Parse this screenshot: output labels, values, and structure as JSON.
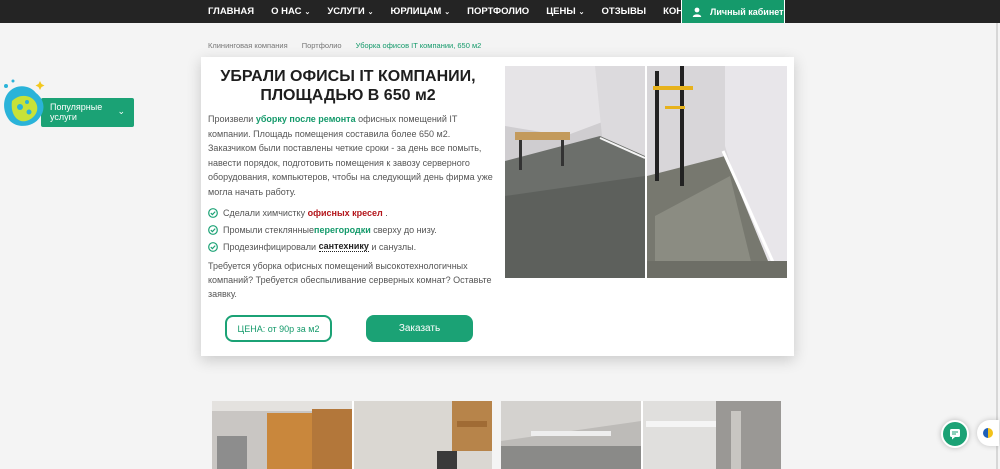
{
  "nav": {
    "items": [
      {
        "label": "ГЛАВНАЯ",
        "has_menu": false
      },
      {
        "label": "О НАС",
        "has_menu": true
      },
      {
        "label": "УСЛУГИ",
        "has_menu": true
      },
      {
        "label": "ЮРЛИЦАМ",
        "has_menu": true
      },
      {
        "label": "ПОРТФОЛИО",
        "has_menu": false
      },
      {
        "label": "ЦЕНЫ",
        "has_menu": true
      },
      {
        "label": "ОТЗЫВЫ",
        "has_menu": false
      },
      {
        "label": "КОНТАКТЫ",
        "has_menu": false
      }
    ],
    "cabinet_label": "Личный кабинет",
    "chevron_glyph": "⌄"
  },
  "breadcrumb": {
    "items": [
      "Клининговая компания",
      "Портфолио"
    ],
    "current": "Уборка офисов IT компании, 650 м2"
  },
  "popular": {
    "label": "Популярные услуги",
    "icon": "sponge-icon"
  },
  "card": {
    "title": "УБРАЛИ ОФИСЫ IT КОМПАНИИ, ПЛОЩАДЬЮ В 650 м2",
    "intro": {
      "before": "Произвели ",
      "link": "уборку после ремонта",
      "after": " офисных помещений IT компании. Площадь помещения составила более 650 м2. Заказчиком были поставлены четкие сроки - за день все помыть, навести порядок, подготовить помещения к завозу серверного оборудования, компьютеров, чтобы на следующий день фирма уже могла начать работу."
    },
    "checks": [
      {
        "before": "Сделали химчистку ",
        "highlight": "офисных кресел",
        "after": " ."
      },
      {
        "before": "Промыли стеклянные",
        "highlight": "перегородки",
        "after": " сверху до низу."
      },
      {
        "before": "Продезинфицировали ",
        "highlight": "сантехнику",
        "after": " и санузлы."
      }
    ],
    "note": "Требуется уборка офисных помещений высокотехнологичных компаний? Требуется обеспыливание серверных комнат? Оставьте заявку.",
    "price_label": "ЦЕНА: от 90р за м2",
    "order_label": "Заказать"
  },
  "colors": {
    "accent": "#1ba275",
    "nav_bg": "#242424",
    "highlight_red": "#b3151b"
  },
  "widgets": {
    "chat_icon": "chat-icon",
    "circle_icon": "accessibility-icon"
  }
}
